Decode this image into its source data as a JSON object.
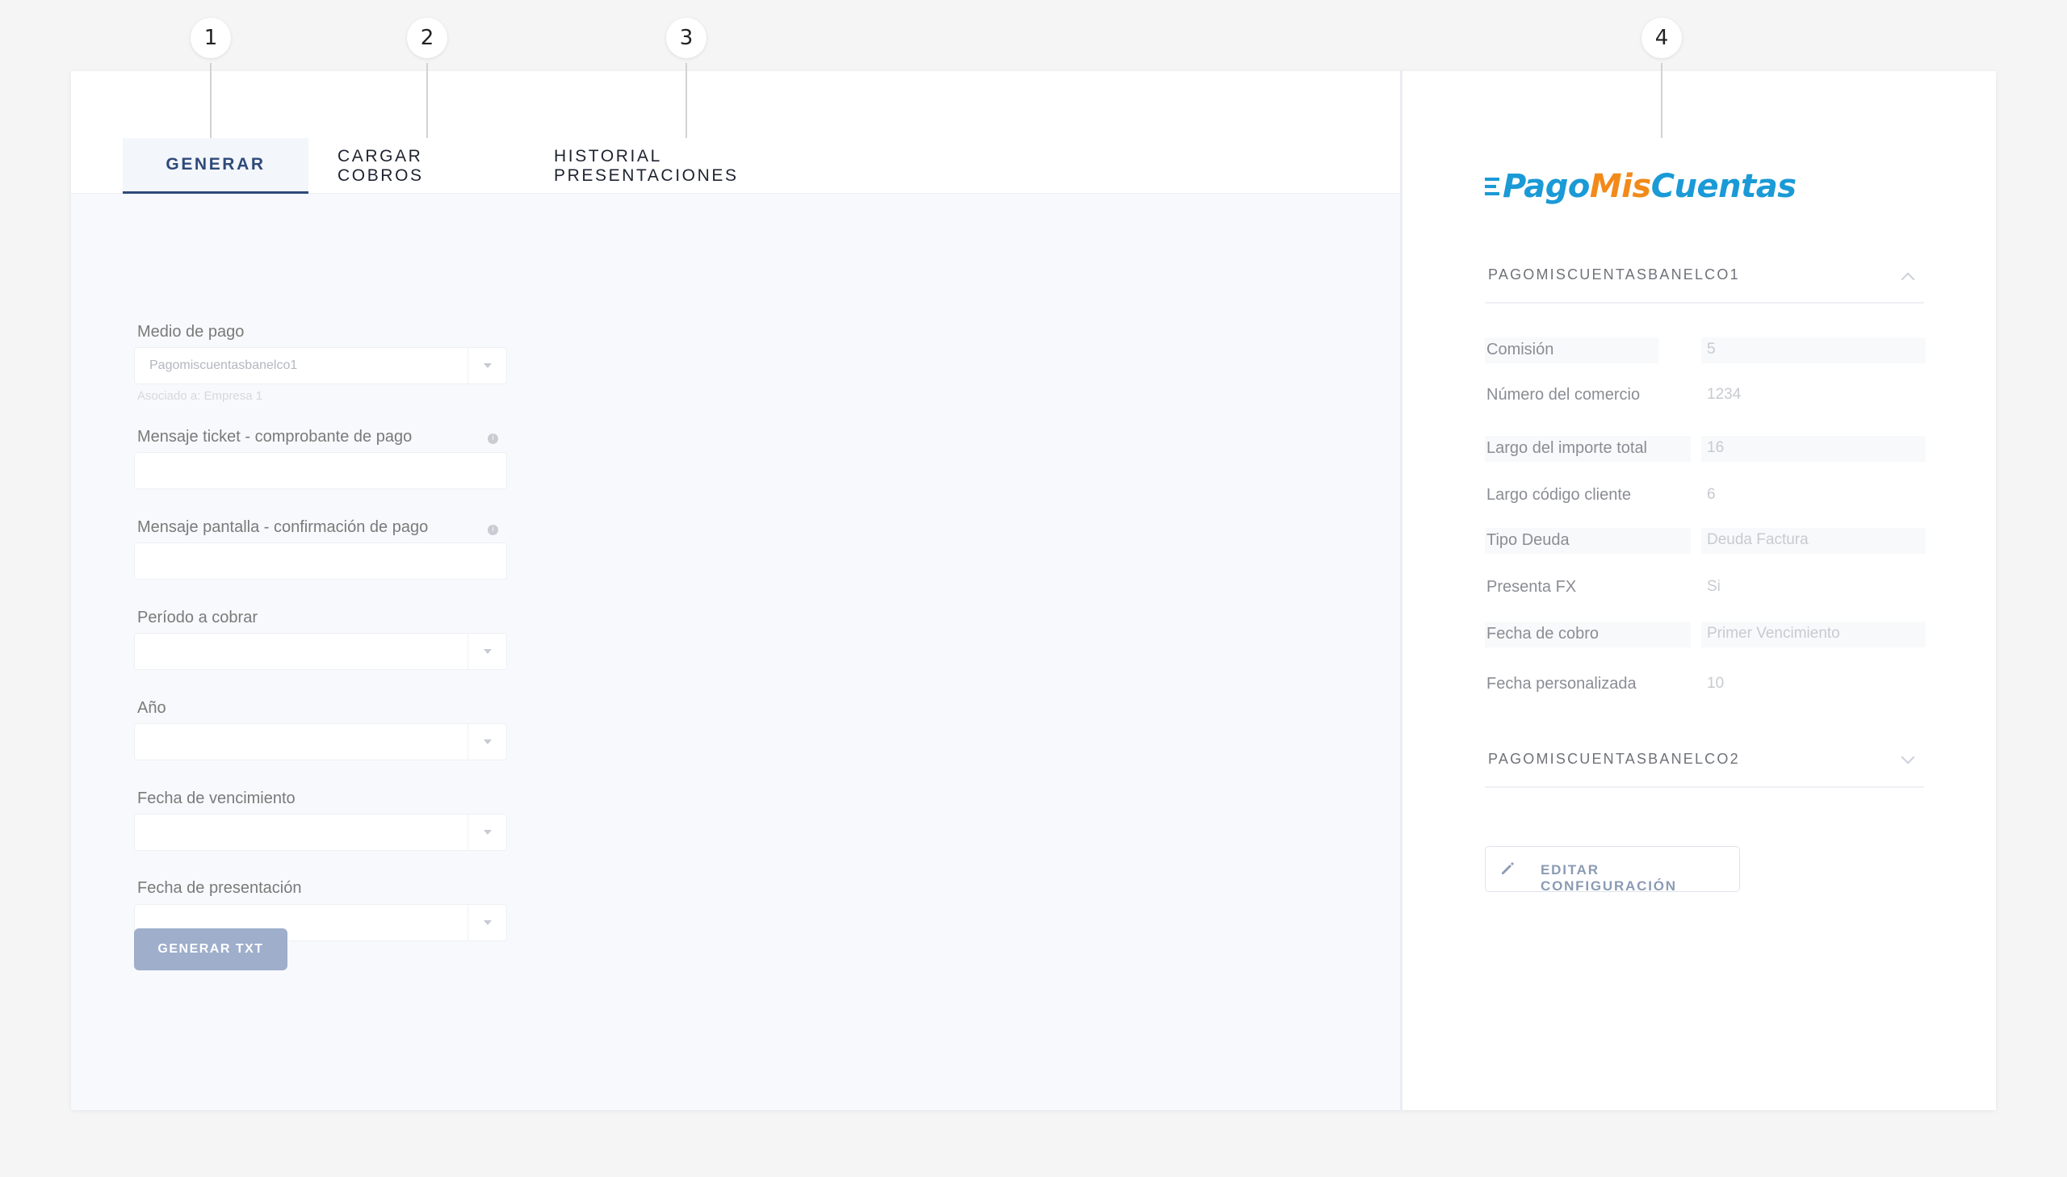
{
  "markers": [
    "1",
    "2",
    "3",
    "4"
  ],
  "tabs": {
    "generar": "GENERAR",
    "cargar": "CARGAR COBROS",
    "historial": "HISTORIAL PRESENTACIONES"
  },
  "form": {
    "medio_pago": {
      "label": "Medio de pago",
      "value": "Pagomiscuentasbanelco1",
      "hint": "Asociado a: Empresa 1"
    },
    "mensaje_ticket": {
      "label": "Mensaje ticket - comprobante de pago",
      "value": ""
    },
    "mensaje_pantalla": {
      "label": "Mensaje pantalla - confirmación de pago",
      "value": ""
    },
    "periodo": {
      "label": "Período a cobrar",
      "value": ""
    },
    "anio": {
      "label": "Año",
      "value": ""
    },
    "fecha_vencimiento": {
      "label": "Fecha de vencimiento",
      "value": ""
    },
    "fecha_presentacion": {
      "label": "Fecha de presentación",
      "value": ""
    },
    "generar_button": "GENERAR TXT"
  },
  "right": {
    "logo": {
      "pago": "Pago",
      "mis": "Mis",
      "cuentas": "Cuentas"
    },
    "accordion1": {
      "title": "PAGOMISCUENTASBANELCO1",
      "rows": [
        {
          "key": "Comisión",
          "value": "5"
        },
        {
          "key": "Número del comercio",
          "value": "1234"
        },
        {
          "key": "Largo del importe total",
          "value": "16"
        },
        {
          "key": "Largo código cliente",
          "value": "6"
        },
        {
          "key": "Tipo Deuda",
          "value": "Deuda Factura"
        },
        {
          "key": "Presenta FX",
          "value": "Si"
        },
        {
          "key": "Fecha de cobro",
          "value": "Primer Vencimiento"
        },
        {
          "key": "Fecha personalizada",
          "value": "10"
        }
      ]
    },
    "accordion2": {
      "title": "PAGOMISCUENTASBANELCO2"
    },
    "edit_button": "EDITAR CONFIGURACIÓN"
  },
  "colors": {
    "accent": "#2f4a7a",
    "button_primary": "#9eaecb",
    "logo_blue": "#1a9ad6",
    "logo_orange": "#f28a1a"
  }
}
